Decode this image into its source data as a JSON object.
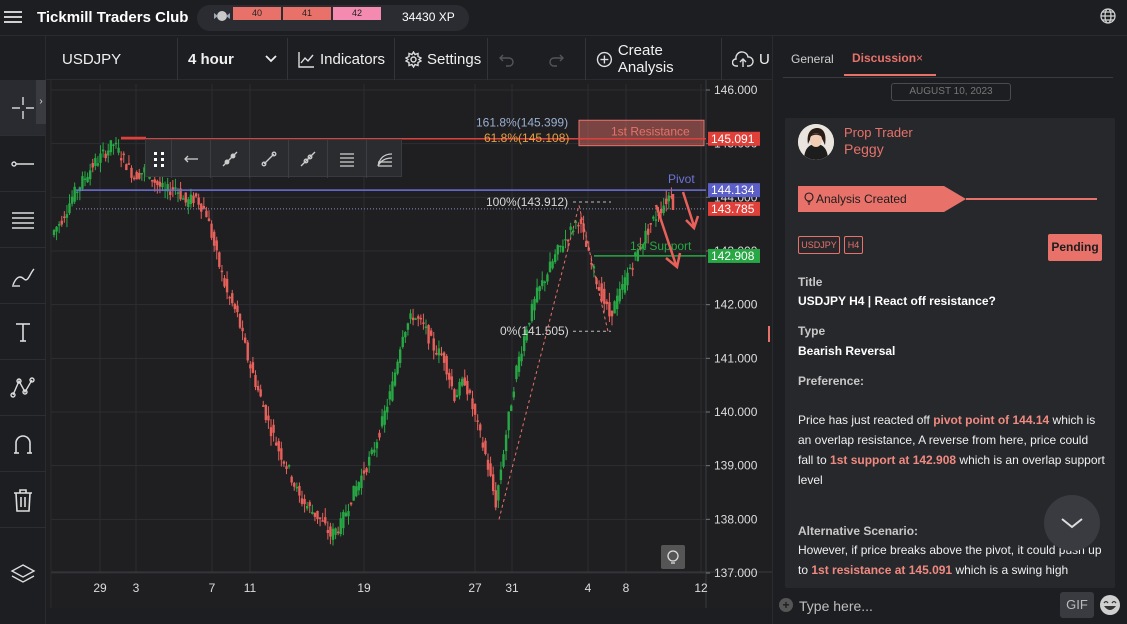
{
  "app": {
    "title": "Tickmill Traders Club"
  },
  "xp": {
    "levels": [
      "40",
      "41",
      "42"
    ],
    "points": "34430 XP"
  },
  "chart_toolbar": {
    "symbol": "USDJPY",
    "timeframe": "4 hour",
    "indicators": "Indicators",
    "settings": "Settings",
    "create_analysis": "Create Analysis",
    "upload_partial": "U"
  },
  "chart_data": {
    "type": "candlestick",
    "symbol": "USDJPY",
    "y_axis_ticks": [
      "146.000",
      "145.000",
      "144.000",
      "143.000",
      "142.000",
      "141.000",
      "140.000",
      "139.000",
      "138.000",
      "137.000"
    ],
    "ylim": [
      137.0,
      146.0
    ],
    "x_axis_ticks": [
      "29",
      "3",
      "7",
      "11",
      "19",
      "27",
      "31",
      "4",
      "8",
      "12"
    ],
    "price_labels": [
      {
        "value": "145.091",
        "color": "#e0403a"
      },
      {
        "value": "144.134",
        "color": "#5b5fc7"
      },
      {
        "value": "143.785",
        "color": "#e0403a"
      },
      {
        "value": "142.908",
        "color": "#27a844"
      }
    ],
    "fibonacci": [
      {
        "label": "161.8%(145.399)",
        "value": 145.399
      },
      {
        "label": "61.8%(145.108)",
        "value": 145.108
      },
      {
        "label": "100%(143.912)",
        "value": 143.912
      },
      {
        "label": "0%(141.505)",
        "value": 141.505
      }
    ],
    "annotations": [
      {
        "text": "1st Resistance",
        "value": 145.091,
        "color": "#e8726a"
      },
      {
        "text": "Pivot",
        "value": 144.134,
        "color": "#6f73d9"
      },
      {
        "text": "1st Support",
        "value": 142.908,
        "color": "#27a844"
      }
    ],
    "series_close": [
      143.3,
      143.6,
      144.0,
      144.3,
      144.6,
      144.8,
      145.0,
      144.7,
      144.4,
      144.5,
      144.3,
      144.1,
      144.2,
      143.9,
      144.0,
      143.7,
      142.9,
      142.2,
      141.8,
      141.0,
      140.4,
      139.8,
      139.3,
      138.9,
      138.4,
      138.2,
      138.0,
      137.7,
      137.9,
      138.4,
      138.8,
      139.2,
      139.8,
      140.5,
      141.5,
      141.8,
      141.6,
      141.2,
      141.0,
      140.3,
      140.6,
      139.9,
      139.2,
      138.3,
      139.6,
      140.8,
      141.6,
      142.2,
      142.6,
      143.0,
      143.3,
      143.6,
      142.9,
      142.3,
      141.8,
      142.2,
      142.7,
      143.1,
      143.5,
      143.8,
      144.1
    ]
  },
  "floating_tools": [
    "arrow-left-icon",
    "ray-icon",
    "trend-line-icon",
    "extended-line-icon",
    "parallel-channel-icon",
    "fib-channel-icon"
  ],
  "panel": {
    "tabs": {
      "general": "General",
      "discussion": "Discussion",
      "close": "×"
    },
    "date": "AUGUST 10, 2023",
    "author_role": "Prop Trader",
    "author_name": "Peggy",
    "banner": "Analysis Created",
    "tags": [
      "USDJPY",
      "H4"
    ],
    "status": "Pending",
    "title_label": "Title",
    "title_value": "USDJPY H4 | React off resistance?",
    "type_label": "Type",
    "type_value": "Bearish Reversal",
    "preference_label": "Preference:",
    "preference_p1": "Price has just reacted off ",
    "preference_h1": "pivot point of 144.14",
    "preference_p2": " which is an overlap resistance, A reverse from here, price could fall to ",
    "preference_h2": "1st support at 142.908",
    "preference_p3": " which is an overlap support level",
    "alt_label": "Alternative Scenario:",
    "alt_p1": "However, if price breaks above the pivot, it could push up to ",
    "alt_h1": "1st resistance at 145.091",
    "alt_p2": " which is a swing high",
    "chat_placeholder": "Type here...",
    "gif": "GIF"
  },
  "colors": {
    "accent": "#e8726a",
    "bull": "#27a844",
    "bear": "#e0403a",
    "pivot": "#5b5fc7"
  }
}
